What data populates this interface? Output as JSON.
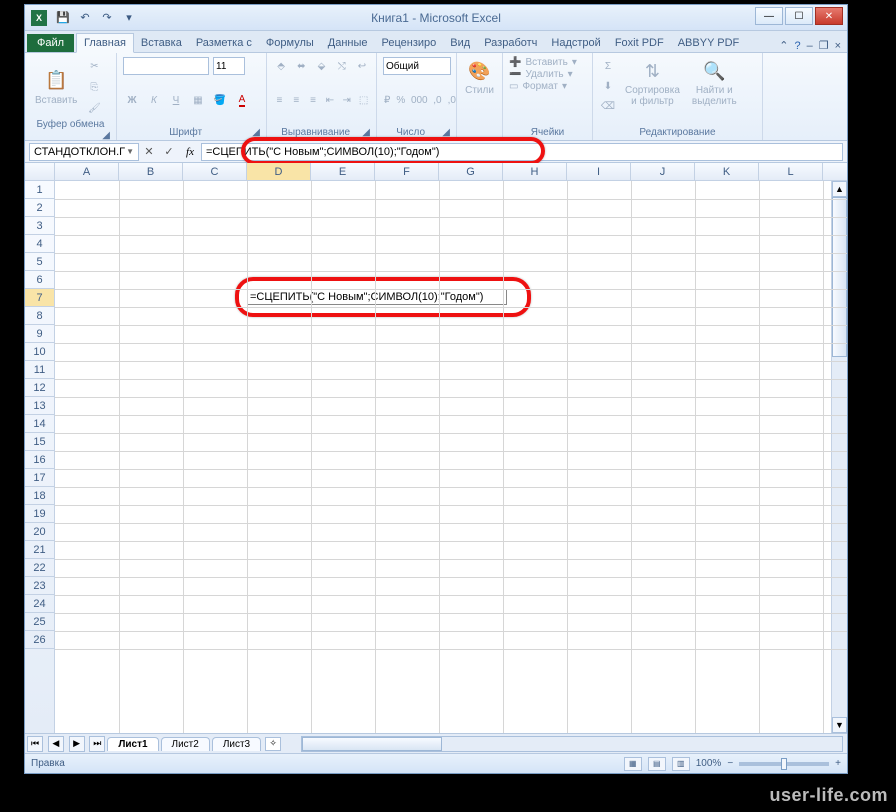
{
  "title": "Книга1 - Microsoft Excel",
  "qat": {
    "save": "💾",
    "undo": "↶",
    "redo": "↷"
  },
  "tabs": {
    "file": "Файл",
    "items": [
      "Главная",
      "Вставка",
      "Разметка с",
      "Формулы",
      "Данные",
      "Рецензиро",
      "Вид",
      "Разработч",
      "Надстрой",
      "Foxit PDF",
      "ABBYY PDF"
    ],
    "active_index": 0
  },
  "ribbon": {
    "clipboard": {
      "paste": "Вставить",
      "label": "Буфер обмена"
    },
    "font": {
      "font_name": "",
      "font_size": "11",
      "label": "Шрифт"
    },
    "alignment": {
      "label": "Выравнивание"
    },
    "number": {
      "format": "Общий",
      "label": "Число"
    },
    "styles": {
      "btn": "Стили",
      "label": ""
    },
    "cells": {
      "insert": "Вставить",
      "delete": "Удалить",
      "format": "Формат",
      "label": "Ячейки"
    },
    "editing": {
      "sort": "Сортировка\nи фильтр",
      "find": "Найти и\nвыделить",
      "label": "Редактирование"
    }
  },
  "formula_bar": {
    "namebox": "СТАНДОТКЛОН.Г",
    "formula": "=СЦЕПИТЬ(\"С Новым\";СИМВОЛ(10);\"Годом\")"
  },
  "columns": [
    "A",
    "B",
    "C",
    "D",
    "E",
    "F",
    "G",
    "H",
    "I",
    "J",
    "K",
    "L"
  ],
  "active_col_index": 3,
  "rows": [
    1,
    2,
    3,
    4,
    5,
    6,
    7,
    8,
    9,
    10,
    11,
    12,
    13,
    14,
    15,
    16,
    17,
    18,
    19,
    20,
    21,
    22,
    23,
    24,
    25,
    26
  ],
  "active_row_index": 6,
  "cell_edit": "=СЦЕПИТЬ(\"С Новым\";СИМВОЛ(10);\"Годом\")",
  "sheets": {
    "items": [
      "Лист1",
      "Лист2",
      "Лист3"
    ],
    "active": 0
  },
  "status": {
    "mode": "Правка",
    "zoom": "100%"
  },
  "watermark": "user-life.com"
}
